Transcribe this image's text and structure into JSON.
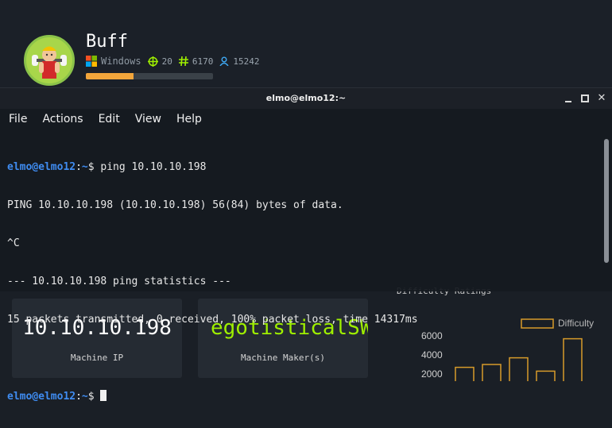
{
  "machine": {
    "name": "Buff",
    "os": "Windows",
    "stat_points": "20",
    "stat_owns": "6170",
    "stat_users": "15242",
    "progress_fraction": 0.375
  },
  "terminal": {
    "title": "elmo@elmo12:~",
    "menu": [
      "File",
      "Actions",
      "Edit",
      "View",
      "Help"
    ],
    "user_host": "elmo@elmo12",
    "prompt_sep": ":",
    "path": "~",
    "prompt_symbol": "$ ",
    "command": "ping 10.10.10.198",
    "output": [
      "PING 10.10.10.198 (10.10.10.198) 56(84) bytes of data.",
      "^C",
      "--- 10.10.10.198 ping statistics ---",
      "15 packets transmitted, 0 received, 100% packet loss, time 14317ms"
    ]
  },
  "cards": {
    "ip_value": "10.10.10.198",
    "ip_label": "Machine IP",
    "maker_value": "egotisticalSW",
    "maker_label": "Machine Maker(s)"
  },
  "difficulty_chart": {
    "title": "Difficulty Ratings",
    "legend": "Difficulty",
    "y_ticks": [
      "6000",
      "4000",
      "2000"
    ]
  },
  "chart_data": {
    "type": "bar",
    "title": "Difficulty Ratings",
    "series": [
      {
        "name": "Difficulty",
        "values": [
          2700,
          3000,
          3700,
          2300,
          5700
        ]
      }
    ],
    "ylim": [
      0,
      7000
    ],
    "y_ticks": [
      2000,
      4000,
      6000
    ],
    "legend": "top-right"
  },
  "colors": {
    "accent_green": "#9fef00",
    "progress_orange": "#f2a53b",
    "prompt_blue": "#3f8cf1",
    "bar_outline": "#d79b2a"
  },
  "icons": {
    "os": "windows-icon",
    "points": "target-icon",
    "owns": "hash-icon",
    "users": "user-icon"
  }
}
